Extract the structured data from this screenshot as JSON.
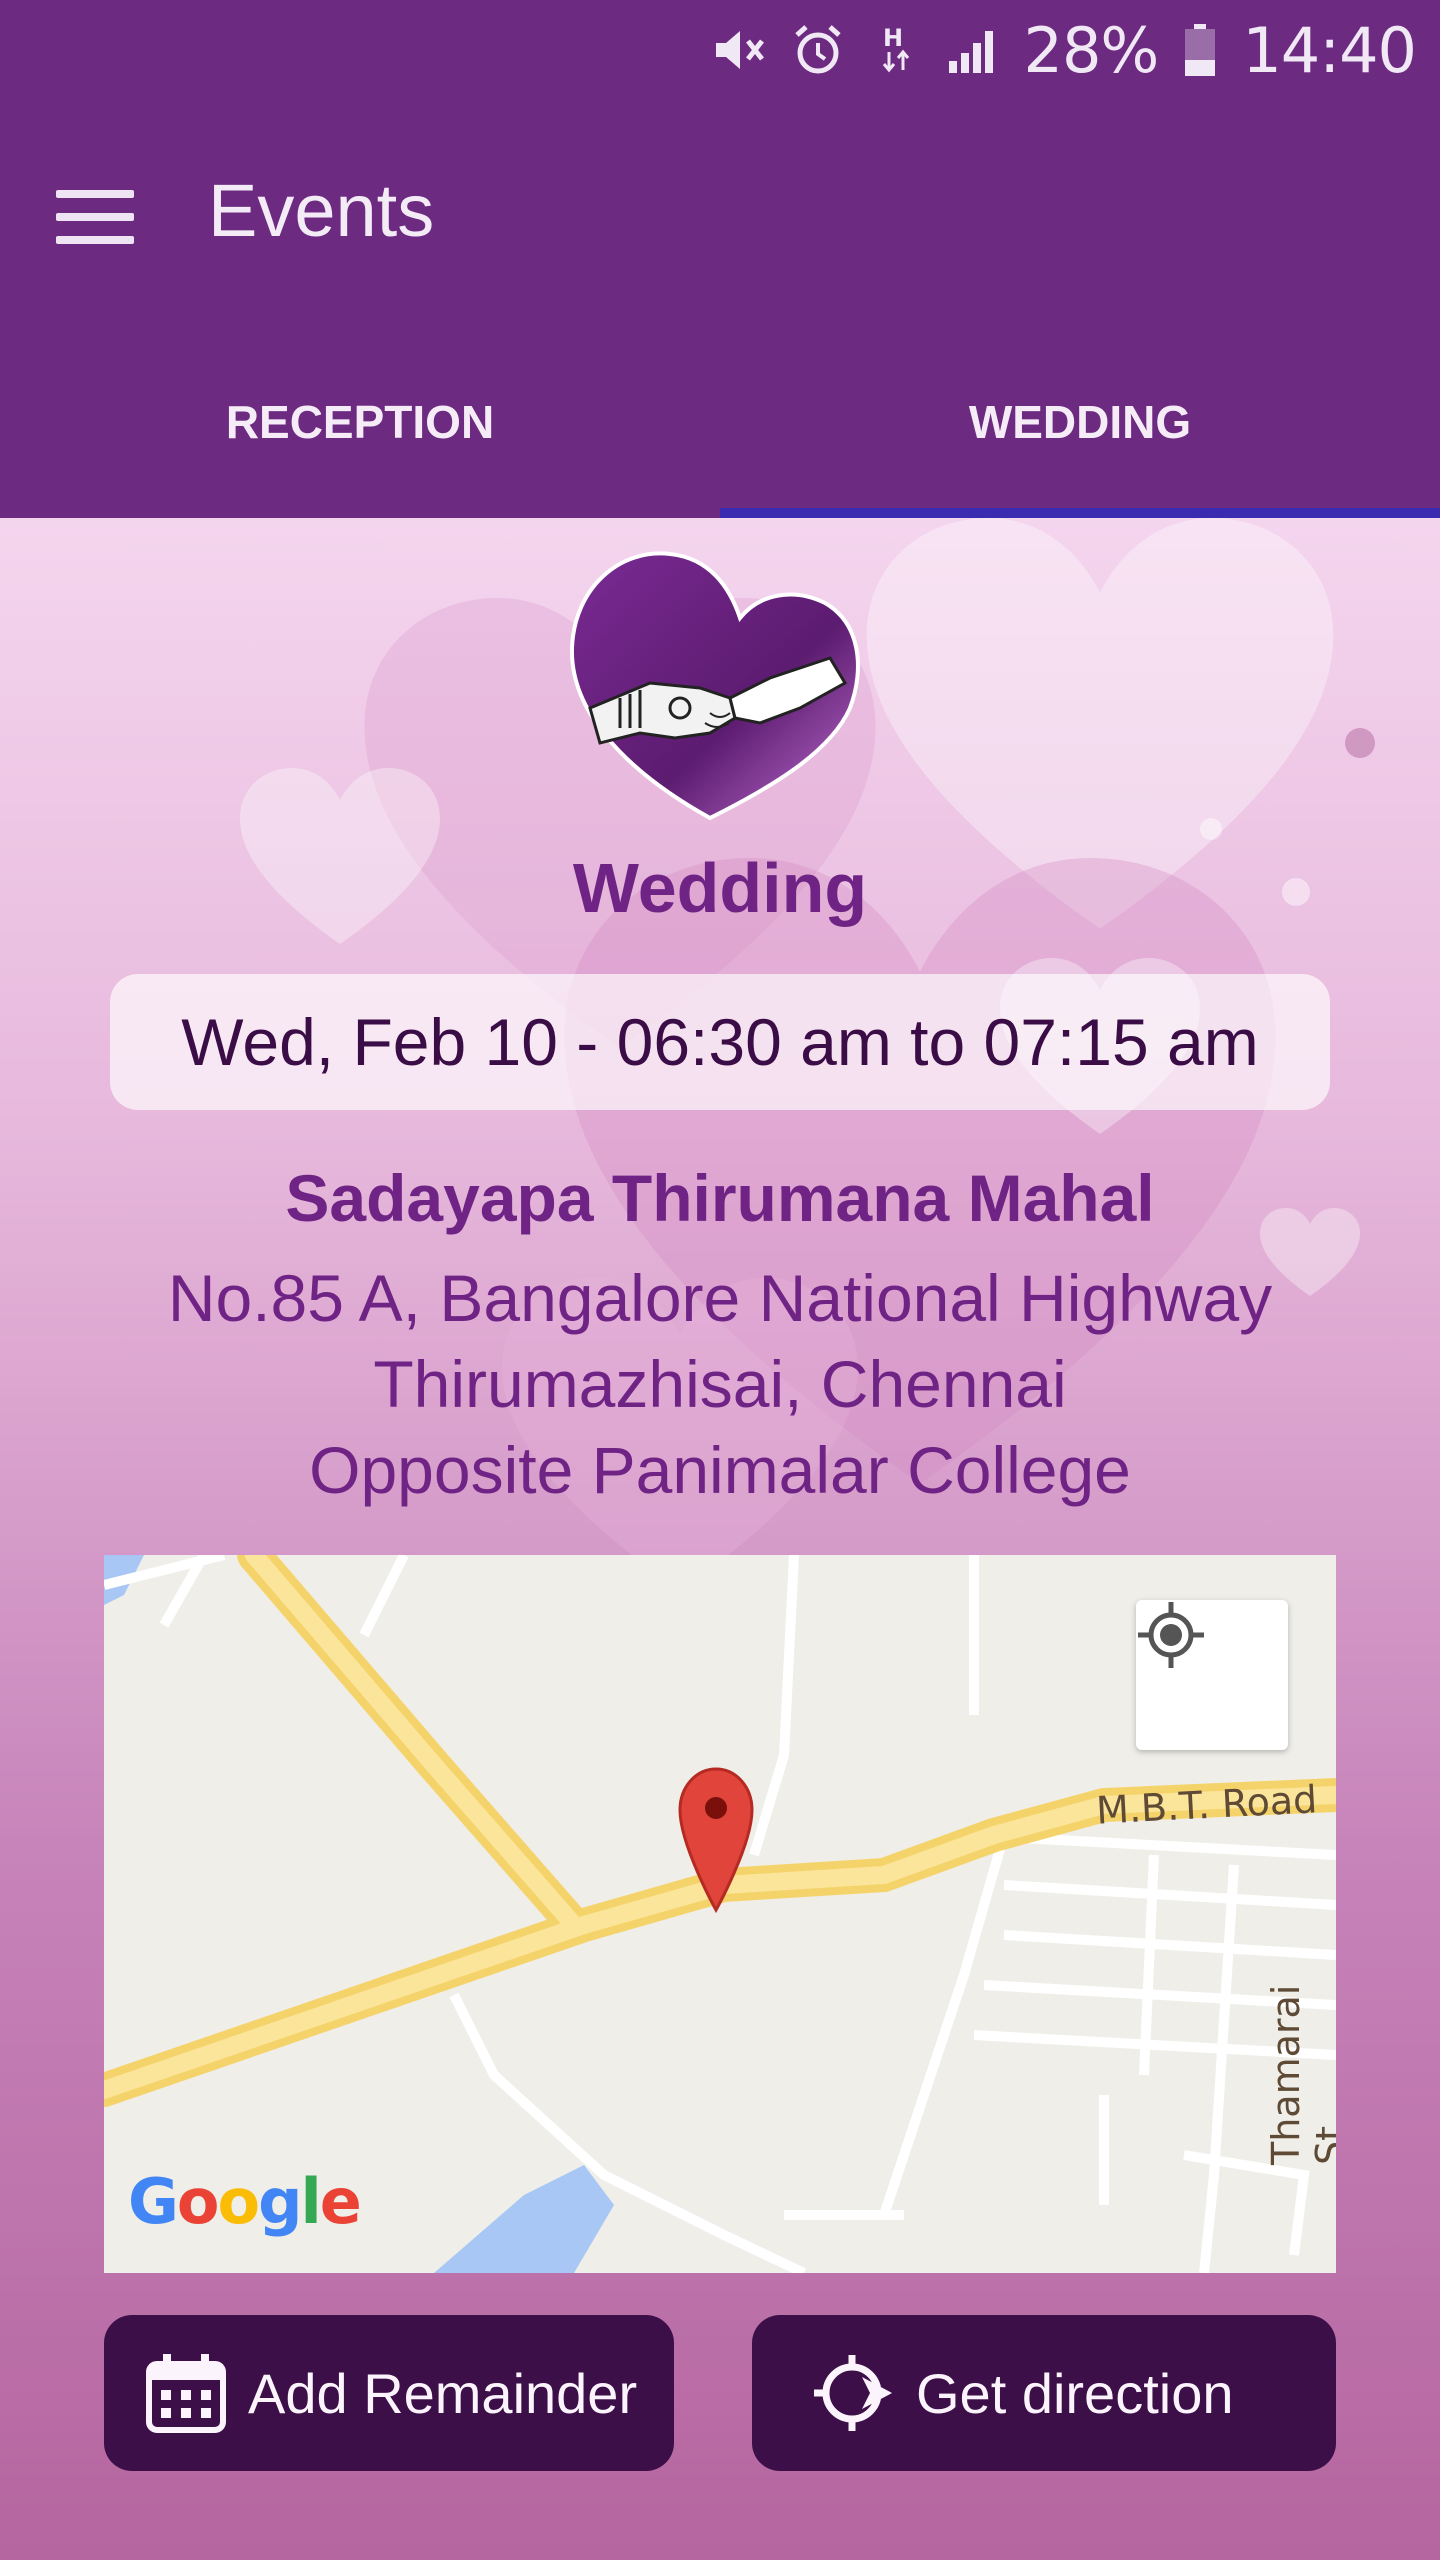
{
  "status_bar": {
    "battery": "28%",
    "time": "14:40",
    "icons": [
      "mute-icon",
      "alarm-icon",
      "hspa-data-icon",
      "signal-icon",
      "battery-icon"
    ]
  },
  "app_bar": {
    "title": "Events",
    "menu_icon": "hamburger-menu-icon"
  },
  "tabs": [
    {
      "label": "RECEPTION",
      "active": false
    },
    {
      "label": "WEDDING",
      "active": true
    }
  ],
  "event": {
    "name": "Wedding",
    "datetime": "Wed, Feb 10 - 06:30 am to 07:15 am",
    "venue": "Sadayapa Thirumana Mahal",
    "address_line1": "No.85 A, Bangalore National Highway",
    "address_line2": "Thirumazhisai, Chennai",
    "address_line3": "Opposite Panimalar College"
  },
  "map": {
    "road_label_1": "M.B.T. Road",
    "road_label_2": "Thamarai St",
    "attribution": "Google",
    "locate_icon": "my-location-icon",
    "marker_icon": "map-pin-icon"
  },
  "actions": {
    "add_reminder": "Add Remainder",
    "get_direction": "Get direction"
  },
  "colors": {
    "primary": "#6c2b80",
    "tab_indicator": "#3b2bb0",
    "accent_text": "#6f2485",
    "button_bg": "#3d0f48"
  }
}
